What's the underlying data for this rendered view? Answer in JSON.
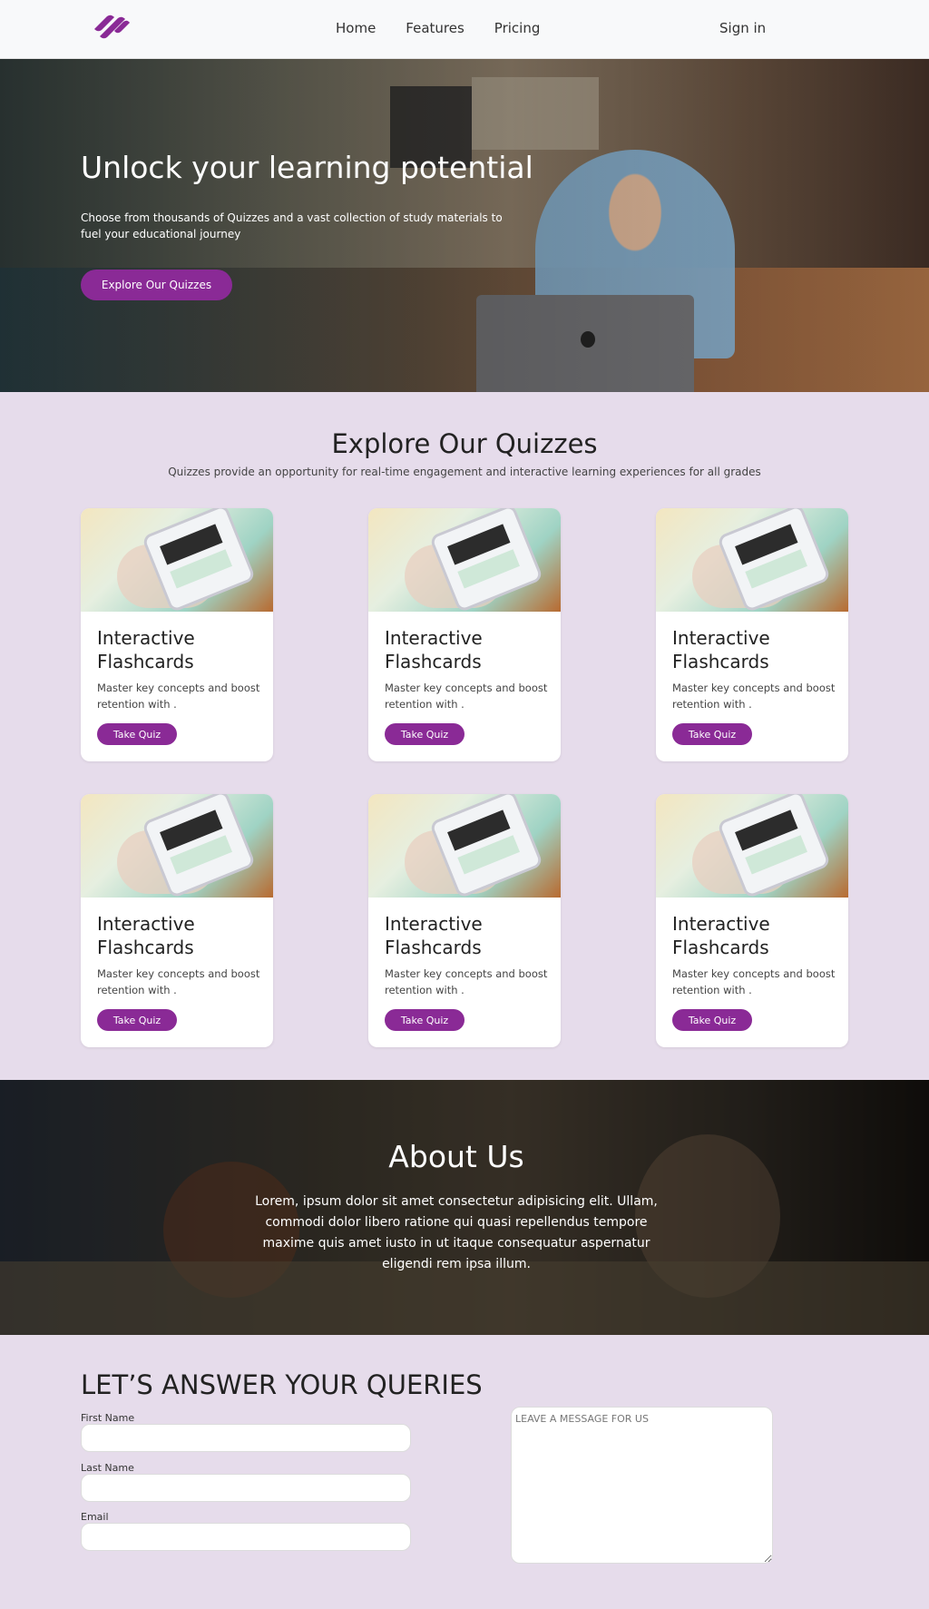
{
  "nav": {
    "links": [
      "Home",
      "Features",
      "Pricing"
    ],
    "sign_in": "Sign in",
    "logo_icon": "brand-logo-icon",
    "brand_color": "#8a2a96"
  },
  "hero": {
    "title": "Unlock your learning potential",
    "subtitle": "Choose from thousands of Quizzes and a vast collection of study materials to fuel your educational journey",
    "button": "Explore Our Quizzes"
  },
  "quizzes": {
    "title": "Explore Our Quizzes",
    "subtitle": "Quizzes provide an opportunity for real-time engagement and interactive learning experiences for all grades",
    "cards": [
      {
        "title": "Interactive Flashcards",
        "desc": "Master key concepts and boost retention with .",
        "button": "Take Quiz"
      },
      {
        "title": "Interactive Flashcards",
        "desc": "Master key concepts and boost retention with .",
        "button": "Take Quiz"
      },
      {
        "title": "Interactive Flashcards",
        "desc": "Master key concepts and boost retention with .",
        "button": "Take Quiz"
      },
      {
        "title": "Interactive Flashcards",
        "desc": "Master key concepts and boost retention with .",
        "button": "Take Quiz"
      },
      {
        "title": "Interactive Flashcards",
        "desc": "Master key concepts and boost retention with .",
        "button": "Take Quiz"
      },
      {
        "title": "Interactive Flashcards",
        "desc": "Master key concepts and boost retention with .",
        "button": "Take Quiz"
      }
    ]
  },
  "about": {
    "title": "About Us",
    "text": "Lorem, ipsum dolor sit amet consectetur adipisicing elit. Ullam, commodi dolor libero ratione qui quasi repellendus tempore maxime quis amet iusto in ut itaque consequatur aspernatur eligendi rem ipsa illum."
  },
  "contact": {
    "title": "LET’S ANSWER YOUR QUERIES",
    "first_name_label": "First Name",
    "last_name_label": "Last Name",
    "email_label": "Email",
    "message_placeholder": "LEAVE A MESSAGE FOR US"
  }
}
